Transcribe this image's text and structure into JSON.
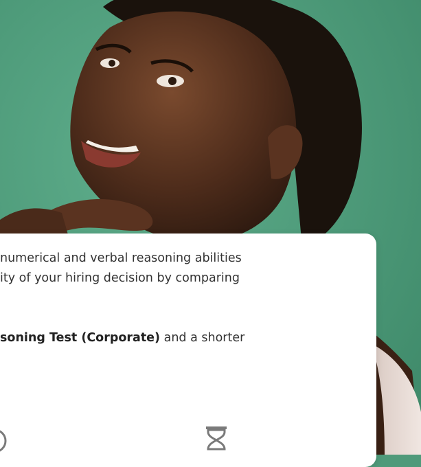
{
  "card": {
    "line1": "numerical and verbal reasoning abilities",
    "line2": "ity of your hiring decision by comparing",
    "line3_bold": "soning Test (Corporate)",
    "line3_rest": " and a shorter"
  },
  "icons": {
    "left": "circle-icon",
    "right": "hourglass-icon"
  },
  "colors": {
    "background": "#4f9a7a",
    "card": "#ffffff",
    "text": "#333333",
    "icon": "#7a7a7a"
  }
}
